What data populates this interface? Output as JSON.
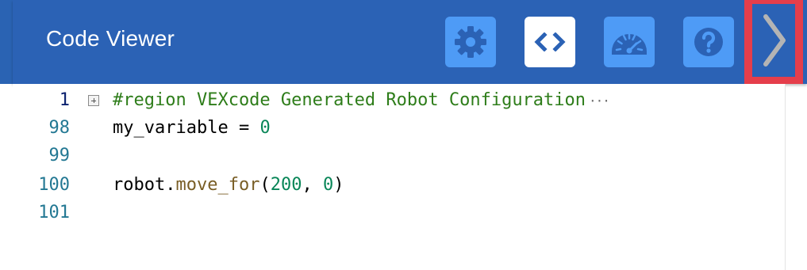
{
  "header": {
    "title": "Code Viewer",
    "buttons": [
      {
        "name": "settings",
        "icon": "gear-icon",
        "active": false
      },
      {
        "name": "code",
        "icon": "code-brackets-icon",
        "active": true
      },
      {
        "name": "dashboard",
        "icon": "speedometer-icon",
        "active": false
      },
      {
        "name": "help",
        "icon": "question-mark-icon",
        "active": false
      }
    ],
    "collapse_icon": "chevron-right-icon"
  },
  "editor": {
    "lines": [
      {
        "number": "1",
        "current": true,
        "foldable": true,
        "tokens": [
          {
            "text": "#region VEXcode Generated Robot Configuration",
            "type": "comment"
          }
        ],
        "folded_marker": "···"
      },
      {
        "number": "98",
        "current": false,
        "foldable": false,
        "tokens": [
          {
            "text": "my_variable = ",
            "type": "plain"
          },
          {
            "text": "0",
            "type": "number"
          }
        ]
      },
      {
        "number": "99",
        "current": false,
        "foldable": false,
        "tokens": []
      },
      {
        "number": "100",
        "current": false,
        "foldable": false,
        "tokens": [
          {
            "text": "robot.",
            "type": "plain"
          },
          {
            "text": "move_for",
            "type": "func"
          },
          {
            "text": "(",
            "type": "plain"
          },
          {
            "text": "200",
            "type": "number"
          },
          {
            "text": ", ",
            "type": "plain"
          },
          {
            "text": "0",
            "type": "number"
          },
          {
            "text": ")",
            "type": "plain"
          }
        ]
      },
      {
        "number": "101",
        "current": false,
        "foldable": false,
        "tokens": []
      }
    ]
  },
  "colors": {
    "header_bg": "#2b62b5",
    "button_bg": "#4e9bf6",
    "button_active_bg": "#ffffff",
    "highlight_border": "#e53e4b"
  }
}
